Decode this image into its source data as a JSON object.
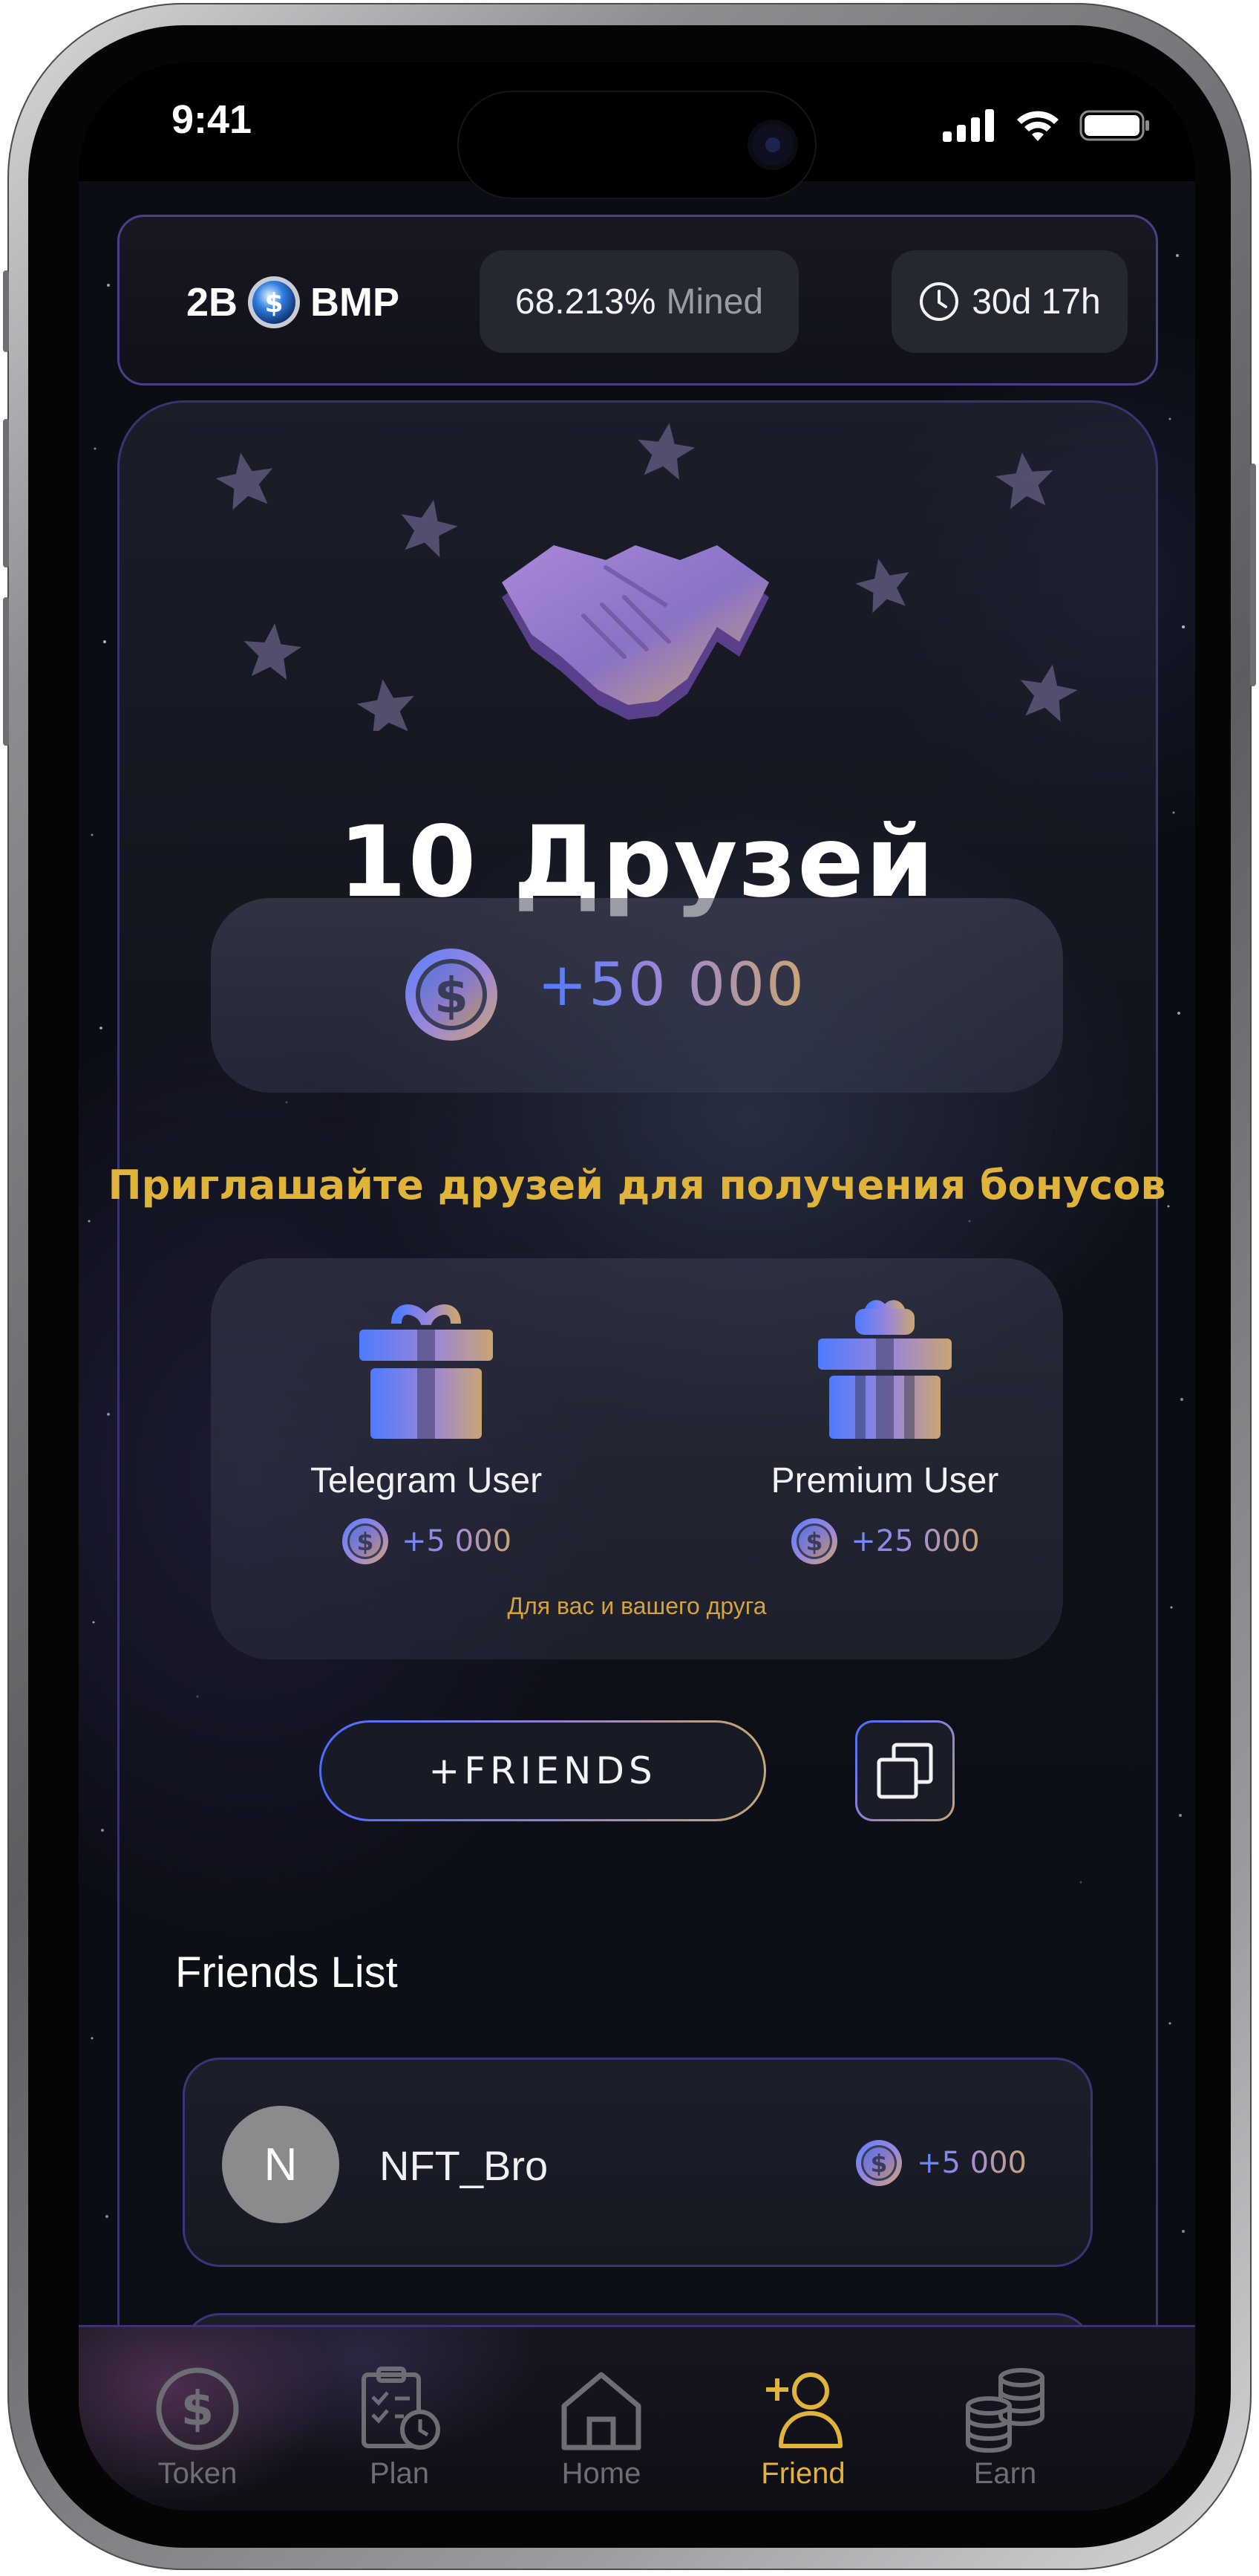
{
  "status_bar": {
    "time": "9:41"
  },
  "top_bar": {
    "supply_amount": "2B",
    "token_symbol": "BMP",
    "mined_percent": "68.213%",
    "mined_label": "Mined",
    "time_left": "30d 17h"
  },
  "hero": {
    "title": "10 Друзей",
    "reward_amount": "+50 000"
  },
  "invite": {
    "title": "Приглашайте друзей для получения бонусов",
    "options": [
      {
        "label": "Telegram User",
        "reward": "+5 000"
      },
      {
        "label": "Premium User",
        "reward": "+25 000"
      }
    ],
    "note": "Для вас и вашего друга",
    "invite_button": "+FRIENDS"
  },
  "friends_list": {
    "title": "Friends List",
    "items": [
      {
        "initial": "N",
        "name": "NFT_Bro",
        "reward": "+5 000"
      }
    ]
  },
  "bottom_nav": {
    "items": [
      {
        "label": "Token",
        "icon": "dollar-coin-icon"
      },
      {
        "label": "Plan",
        "icon": "clipboard-clock-icon"
      },
      {
        "label": "Home",
        "icon": "home-icon"
      },
      {
        "label": "Friend",
        "icon": "add-user-icon",
        "active": true
      },
      {
        "label": "Earn",
        "icon": "coin-stack-icon"
      }
    ]
  },
  "colors": {
    "accent_gold": "#e0b43a",
    "accent_blue": "#4a6cff",
    "accent_purple": "#8e7fd6",
    "border_purple": "#4b3f86",
    "background": "#0b0d15"
  }
}
